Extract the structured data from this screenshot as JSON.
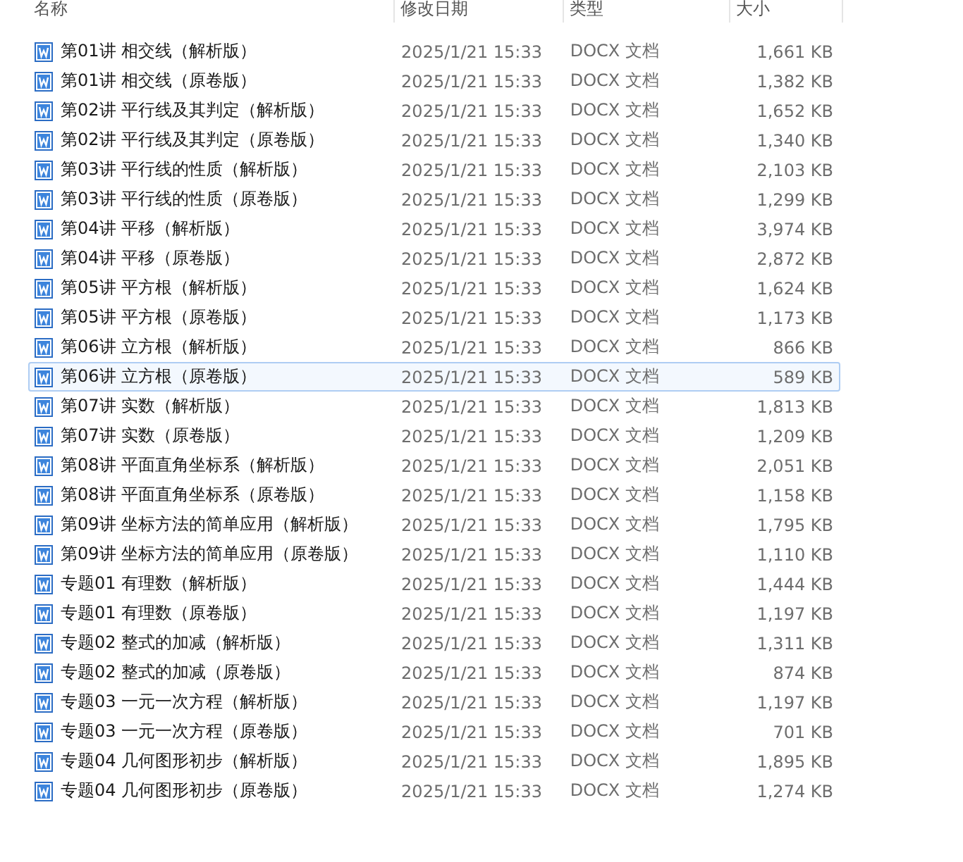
{
  "columns": [
    "名称",
    "修改日期",
    "类型",
    "大小"
  ],
  "files": [
    {
      "name": "第01讲 相交线（解析版）",
      "modified": "2025/1/21 15:33",
      "type": "DOCX 文档",
      "size": "1,661 KB",
      "selected": false
    },
    {
      "name": "第01讲 相交线（原卷版）",
      "modified": "2025/1/21 15:33",
      "type": "DOCX 文档",
      "size": "1,382 KB",
      "selected": false
    },
    {
      "name": "第02讲 平行线及其判定（解析版）",
      "modified": "2025/1/21 15:33",
      "type": "DOCX 文档",
      "size": "1,652 KB",
      "selected": false
    },
    {
      "name": "第02讲 平行线及其判定（原卷版）",
      "modified": "2025/1/21 15:33",
      "type": "DOCX 文档",
      "size": "1,340 KB",
      "selected": false
    },
    {
      "name": "第03讲 平行线的性质（解析版）",
      "modified": "2025/1/21 15:33",
      "type": "DOCX 文档",
      "size": "2,103 KB",
      "selected": false
    },
    {
      "name": "第03讲 平行线的性质（原卷版）",
      "modified": "2025/1/21 15:33",
      "type": "DOCX 文档",
      "size": "1,299 KB",
      "selected": false
    },
    {
      "name": "第04讲 平移（解析版）",
      "modified": "2025/1/21 15:33",
      "type": "DOCX 文档",
      "size": "3,974 KB",
      "selected": false
    },
    {
      "name": "第04讲 平移（原卷版）",
      "modified": "2025/1/21 15:33",
      "type": "DOCX 文档",
      "size": "2,872 KB",
      "selected": false
    },
    {
      "name": "第05讲 平方根（解析版）",
      "modified": "2025/1/21 15:33",
      "type": "DOCX 文档",
      "size": "1,624 KB",
      "selected": false
    },
    {
      "name": "第05讲 平方根（原卷版）",
      "modified": "2025/1/21 15:33",
      "type": "DOCX 文档",
      "size": "1,173 KB",
      "selected": false
    },
    {
      "name": "第06讲 立方根（解析版）",
      "modified": "2025/1/21 15:33",
      "type": "DOCX 文档",
      "size": "866 KB",
      "selected": false
    },
    {
      "name": "第06讲 立方根（原卷版）",
      "modified": "2025/1/21 15:33",
      "type": "DOCX 文档",
      "size": "589 KB",
      "selected": true
    },
    {
      "name": "第07讲 实数（解析版）",
      "modified": "2025/1/21 15:33",
      "type": "DOCX 文档",
      "size": "1,813 KB",
      "selected": false
    },
    {
      "name": "第07讲 实数（原卷版）",
      "modified": "2025/1/21 15:33",
      "type": "DOCX 文档",
      "size": "1,209 KB",
      "selected": false
    },
    {
      "name": "第08讲 平面直角坐标系（解析版）",
      "modified": "2025/1/21 15:33",
      "type": "DOCX 文档",
      "size": "2,051 KB",
      "selected": false
    },
    {
      "name": "第08讲 平面直角坐标系（原卷版）",
      "modified": "2025/1/21 15:33",
      "type": "DOCX 文档",
      "size": "1,158 KB",
      "selected": false
    },
    {
      "name": "第09讲 坐标方法的简单应用（解析版）",
      "modified": "2025/1/21 15:33",
      "type": "DOCX 文档",
      "size": "1,795 KB",
      "selected": false
    },
    {
      "name": "第09讲 坐标方法的简单应用（原卷版）",
      "modified": "2025/1/21 15:33",
      "type": "DOCX 文档",
      "size": "1,110 KB",
      "selected": false
    },
    {
      "name": "专题01 有理数（解析版）",
      "modified": "2025/1/21 15:33",
      "type": "DOCX 文档",
      "size": "1,444 KB",
      "selected": false
    },
    {
      "name": "专题01 有理数（原卷版）",
      "modified": "2025/1/21 15:33",
      "type": "DOCX 文档",
      "size": "1,197 KB",
      "selected": false
    },
    {
      "name": "专题02 整式的加减（解析版）",
      "modified": "2025/1/21 15:33",
      "type": "DOCX 文档",
      "size": "1,311 KB",
      "selected": false
    },
    {
      "name": "专题02 整式的加减（原卷版）",
      "modified": "2025/1/21 15:33",
      "type": "DOCX 文档",
      "size": "874 KB",
      "selected": false
    },
    {
      "name": "专题03 一元一次方程（解析版）",
      "modified": "2025/1/21 15:33",
      "type": "DOCX 文档",
      "size": "1,197 KB",
      "selected": false
    },
    {
      "name": "专题03 一元一次方程（原卷版）",
      "modified": "2025/1/21 15:33",
      "type": "DOCX 文档",
      "size": "701 KB",
      "selected": false
    },
    {
      "name": "专题04 几何图形初步（解析版）",
      "modified": "2025/1/21 15:33",
      "type": "DOCX 文档",
      "size": "1,895 KB",
      "selected": false
    },
    {
      "name": "专题04 几何图形初步（原卷版）",
      "modified": "2025/1/21 15:33",
      "type": "DOCX 文档",
      "size": "1,274 KB",
      "selected": false
    }
  ]
}
